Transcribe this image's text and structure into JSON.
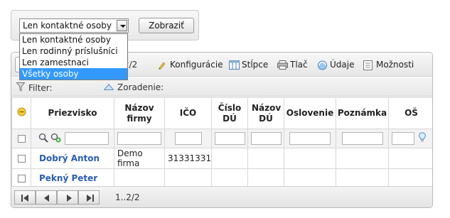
{
  "filter": {
    "select_value": "Len kontaktné osoby",
    "show_button": "Zobraziť",
    "options": [
      "Len kontaktné osoby",
      "Len rodinný príslušníci",
      "Len zamestnaci",
      "Všetky osoby"
    ],
    "selected_option_index": 3
  },
  "toolbar": {
    "page_info": "2/2",
    "configure": "Konfigurácie",
    "columns": "Stĺpce",
    "print": "Tlač",
    "data": "Údaje",
    "options": "Možnosti"
  },
  "filterbar": {
    "filter_label": "Filter:",
    "sort_label": "Zoradenie:"
  },
  "table": {
    "headers": [
      "Priezvisko",
      "Názov firmy",
      "IČO",
      "Číslo DÚ",
      "Názov DÚ",
      "Oslovenie",
      "Poznámka",
      "OŠ"
    ],
    "rows": [
      {
        "name": "Dobrý Anton",
        "firm": "Demo firma",
        "ico": "31331331"
      },
      {
        "name": "Pekný Peter",
        "firm": "",
        "ico": ""
      }
    ]
  },
  "footer": {
    "page_info": "1..2/2"
  },
  "colors": {
    "link": "#2a5db0",
    "selected": "#3399ff"
  }
}
